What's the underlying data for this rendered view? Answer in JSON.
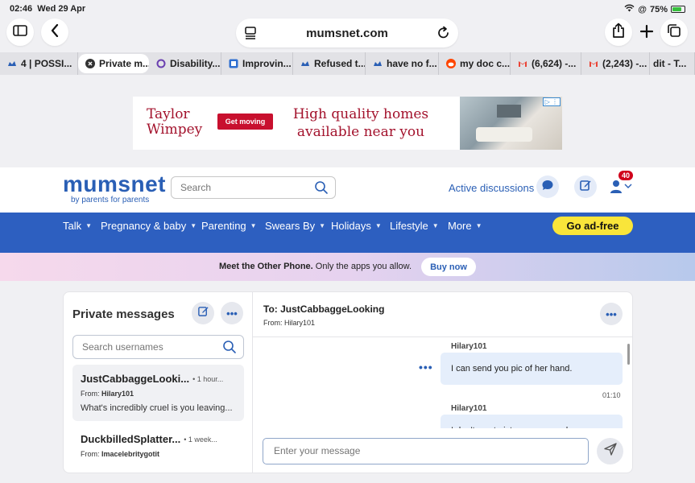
{
  "status": {
    "time": "02:46",
    "date": "Wed 29 Apr",
    "battery": "75%"
  },
  "browser": {
    "url": "mumsnet.com",
    "tabs": [
      {
        "label": "4 | POSSI...",
        "icon": "mumsnet-icon"
      },
      {
        "label": "Private m...",
        "icon": "close-icon",
        "active": true
      },
      {
        "label": "Disability...",
        "icon": "circle-icon"
      },
      {
        "label": "Improvin...",
        "icon": "square-icon"
      },
      {
        "label": "Refused t...",
        "icon": "mumsnet-icon"
      },
      {
        "label": "have no f...",
        "icon": "mumsnet-icon"
      },
      {
        "label": "my doc c...",
        "icon": "reddit-icon"
      },
      {
        "label": "(6,624) -...",
        "icon": "gmail-icon"
      },
      {
        "label": "(2,243) -...",
        "icon": "gmail-icon"
      },
      {
        "label": "dit - T...",
        "icon": ""
      }
    ]
  },
  "ad": {
    "brand_line1": "Taylor",
    "brand_line2": "Wimpey",
    "cta": "Get moving",
    "headline_line1": "High quality homes",
    "headline_line2": "available near you"
  },
  "site": {
    "brand": "mumsnet",
    "tagline": "by parents for parents",
    "search_placeholder": "Search",
    "active_discussions": "Active discussions",
    "notifications": "40"
  },
  "nav": {
    "items": [
      "Talk",
      "Pregnancy & baby",
      "Parenting",
      "Swears By",
      "Holidays",
      "Lifestyle",
      "More"
    ],
    "go_ad_free": "Go ad-free"
  },
  "promo": {
    "bold": "Meet the Other Phone.",
    "text": " Only the apps you allow.",
    "button": "Buy now"
  },
  "pm": {
    "title": "Private messages",
    "search_placeholder": "Search usernames",
    "conversations": [
      {
        "username": "JustCabbaggeLooki...",
        "time": "• 1 hour...",
        "from_label": "From: ",
        "from": "Hilary101",
        "preview": "What's incredibly cruel is you leaving..."
      },
      {
        "username": "DuckbilledSplatter...",
        "time": "• 1 week...",
        "from_label": "From: ",
        "from": "Imacelebritygotit",
        "preview": ""
      }
    ]
  },
  "thread": {
    "to": "To: JustCabbaggeLooking",
    "from": "From: Hilary101",
    "messages": [
      {
        "sender": "Hilary101",
        "text": "I can send you pic of her hand.",
        "time": "01:10"
      },
      {
        "sender": "Hilary101",
        "text": "I don't want pictures, we need...",
        "time": ""
      }
    ],
    "composer_placeholder": "Enter your message"
  },
  "colors": {
    "brand_blue": "#2d5fc0",
    "ad_red": "#c8102e",
    "go_ad_free": "#f9e53a",
    "bubble": "#e5eefb"
  }
}
